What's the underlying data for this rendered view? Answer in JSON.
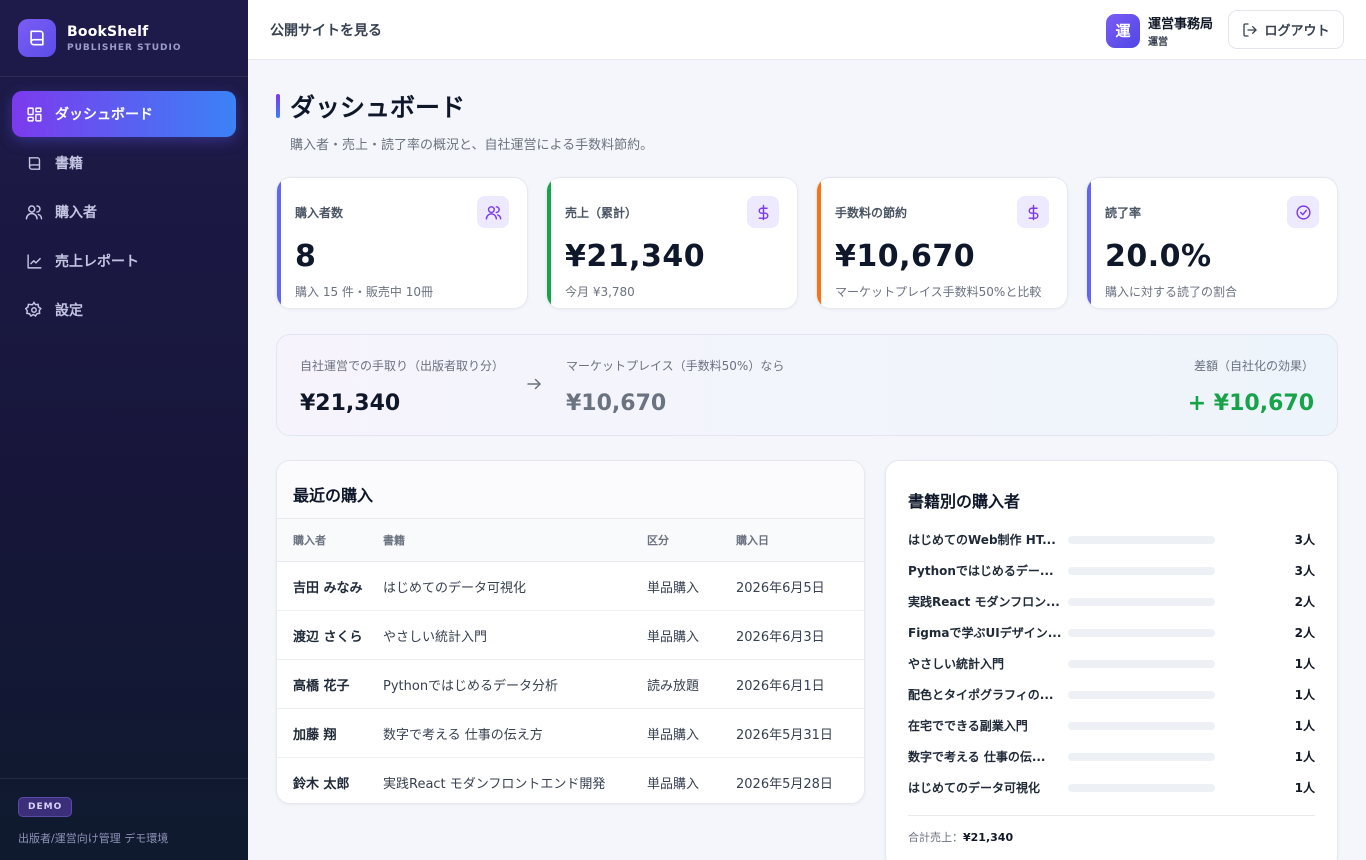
{
  "brand": {
    "name": "BookShelf",
    "subtitle": "PUBLISHER STUDIO"
  },
  "nav": [
    {
      "label": "ダッシュボード",
      "icon": "dashboard-icon",
      "active": true
    },
    {
      "label": "書籍",
      "icon": "book-icon"
    },
    {
      "label": "購入者",
      "icon": "users-icon"
    },
    {
      "label": "売上レポート",
      "icon": "chart-line-icon"
    },
    {
      "label": "設定",
      "icon": "gear-icon"
    }
  ],
  "footer": {
    "badge": "DEMO",
    "text": "出版者/運営向け管理 デモ環境"
  },
  "topbar": {
    "public_link": "公開サイトを見る",
    "user_avatar": "運",
    "user_name": "運営事務局",
    "user_role": "運営",
    "logout": "ログアウト"
  },
  "page": {
    "title": "ダッシュボード",
    "subtitle": "購入者・売上・読了率の概況と、自社運営による手数料節約。"
  },
  "stats": [
    {
      "label": "購入者数",
      "value": "8",
      "note": "購入 15 件・販売中 10冊",
      "icon": "users-icon",
      "accent": "#6366f1"
    },
    {
      "label": "売上（累計）",
      "value": "¥21,340",
      "note": "今月 ¥3,780",
      "icon": "dollar-icon",
      "accent": "#16a34a"
    },
    {
      "label": "手数料の節約",
      "value": "¥10,670",
      "note": "マーケットプレイス手数料50%と比較",
      "icon": "dollar-icon",
      "accent": "#f97316"
    },
    {
      "label": "読了率",
      "value": "20.0%",
      "note": "購入に対する読了の割合",
      "icon": "check-circle-icon",
      "accent": "#6366f1"
    }
  ],
  "comparison": {
    "own_label": "自社運営での手取り（出版者取り分）",
    "own_value": "¥21,340",
    "market_label": "マーケットプレイス（手数料50%）なら",
    "market_value": "¥10,670",
    "diff_label": "差額（自社化の効果）",
    "diff_value": "+ ¥10,670",
    "diff_color": "#16a34a"
  },
  "recent": {
    "title": "最近の購入",
    "headers": [
      "購入者",
      "書籍",
      "区分",
      "購入日"
    ],
    "rows": [
      [
        "吉田 みなみ",
        "はじめてのデータ可視化",
        "単品購入",
        "2026年6月5日"
      ],
      [
        "渡辺 さくら",
        "やさしい統計入門",
        "単品購入",
        "2026年6月3日"
      ],
      [
        "高橋 花子",
        "Pythonではじめるデータ分析",
        "読み放題",
        "2026年6月1日"
      ],
      [
        "加藤 翔",
        "数字で考える 仕事の伝え方",
        "単品購入",
        "2026年5月31日"
      ],
      [
        "鈴木 太郎",
        "実践React モダンフロントエンド開発",
        "単品購入",
        "2026年5月28日"
      ]
    ]
  },
  "by_book": {
    "title": "書籍別の購入者",
    "items": [
      {
        "name": "はじめてのWeb制作 HT...",
        "count": "3人",
        "level": 0
      },
      {
        "name": "Pythonではじめるデー...",
        "count": "3人",
        "level": 0
      },
      {
        "name": "実践React モダンフロン...",
        "count": "2人",
        "level": 0
      },
      {
        "name": "Figmaで学ぶUIデザイン...",
        "count": "2人",
        "level": 0
      },
      {
        "name": "やさしい統計入門",
        "count": "1人",
        "level": 0
      },
      {
        "name": "配色とタイポグラフィの...",
        "count": "1人",
        "level": 0
      },
      {
        "name": "在宅でできる副業入門",
        "count": "1人",
        "level": 0
      },
      {
        "name": "数字で考える 仕事の伝...",
        "count": "1人",
        "level": 0
      },
      {
        "name": "はじめてのデータ可視化",
        "count": "1人",
        "level": 0
      }
    ],
    "total_label": "合計売上：",
    "total_value": "¥21,340"
  }
}
